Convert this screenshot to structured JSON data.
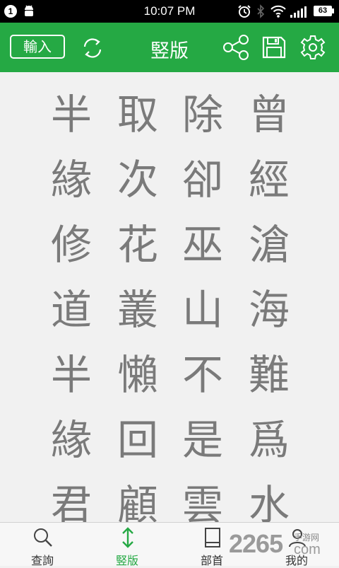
{
  "status_bar": {
    "notification_count": "1",
    "time": "10:07 PM",
    "battery": "63"
  },
  "toolbar": {
    "input_label": "輸入",
    "title": "竪版",
    "colors": {
      "bar": "#25a944",
      "icon": "#ffffff"
    },
    "icons": [
      "refresh-icon",
      "share-icon",
      "save-icon",
      "settings-icon"
    ]
  },
  "content": {
    "columns": [
      [
        "曾",
        "經",
        "滄",
        "海",
        "難",
        "爲",
        "水"
      ],
      [
        "除",
        "卻",
        "巫",
        "山",
        "不",
        "是",
        "雲"
      ],
      [
        "取",
        "次",
        "花",
        "叢",
        "懶",
        "回",
        "顧"
      ],
      [
        "半",
        "緣",
        "修",
        "道",
        "半",
        "緣",
        "君"
      ]
    ]
  },
  "bottom_nav": {
    "items": [
      {
        "label": "查詢",
        "icon": "search-icon"
      },
      {
        "label": "竪版",
        "icon": "vertical-arrow-icon",
        "active": true
      },
      {
        "label": "部首",
        "icon": "book-icon"
      },
      {
        "label": "我的",
        "icon": "user-icon"
      }
    ],
    "active_color": "#25a944"
  },
  "watermark": {
    "number": "2265",
    "site_cn": "手游网",
    "suffix": "com"
  }
}
